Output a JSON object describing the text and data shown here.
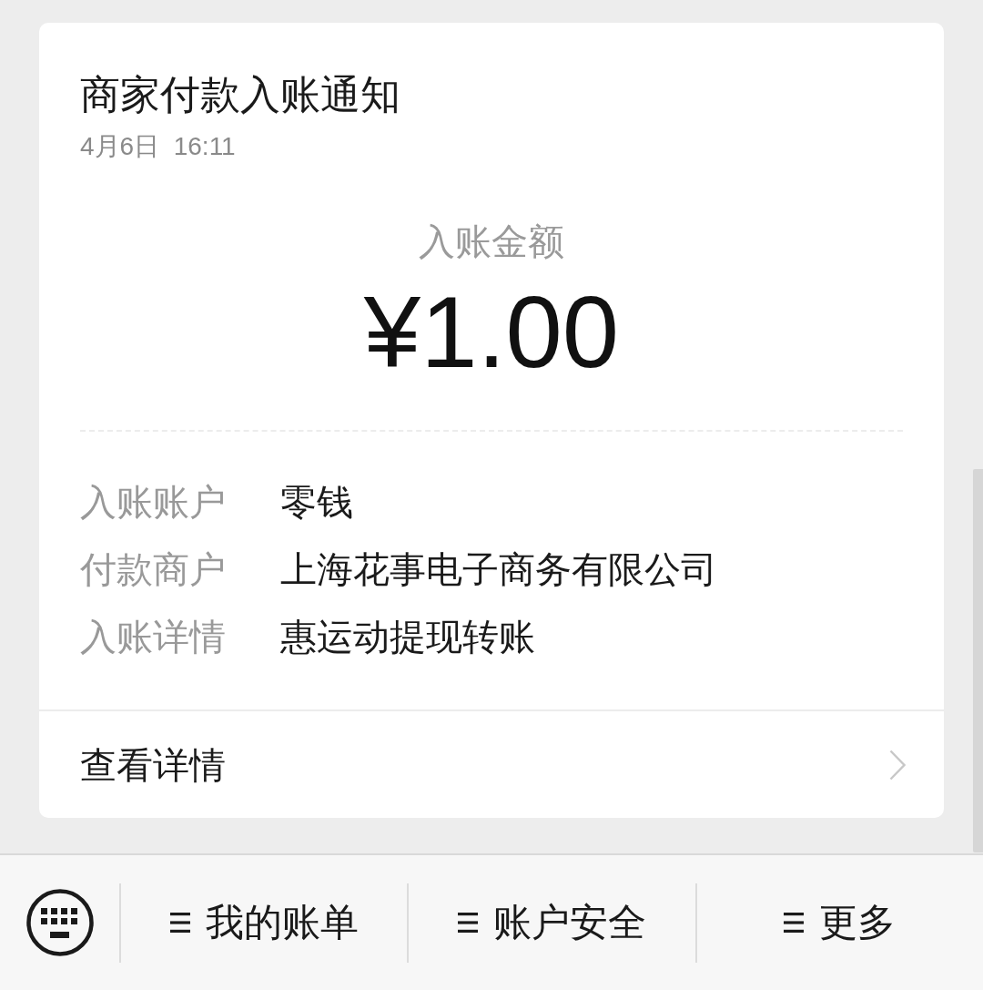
{
  "notification": {
    "title": "商家付款入账通知",
    "time": "4月6日  16:11"
  },
  "amount": {
    "label": "入账金额",
    "value": "¥1.00"
  },
  "details": [
    {
      "label": "入账账户",
      "value": "零钱"
    },
    {
      "label": "付款商户",
      "value": "上海花事电子商务有限公司"
    },
    {
      "label": "入账详情",
      "value": "惠运动提现转账"
    }
  ],
  "view_details": {
    "label": "查看详情"
  },
  "menu_bar": {
    "items": [
      {
        "label": "我的账单"
      },
      {
        "label": "账户安全"
      },
      {
        "label": "更多"
      }
    ]
  }
}
